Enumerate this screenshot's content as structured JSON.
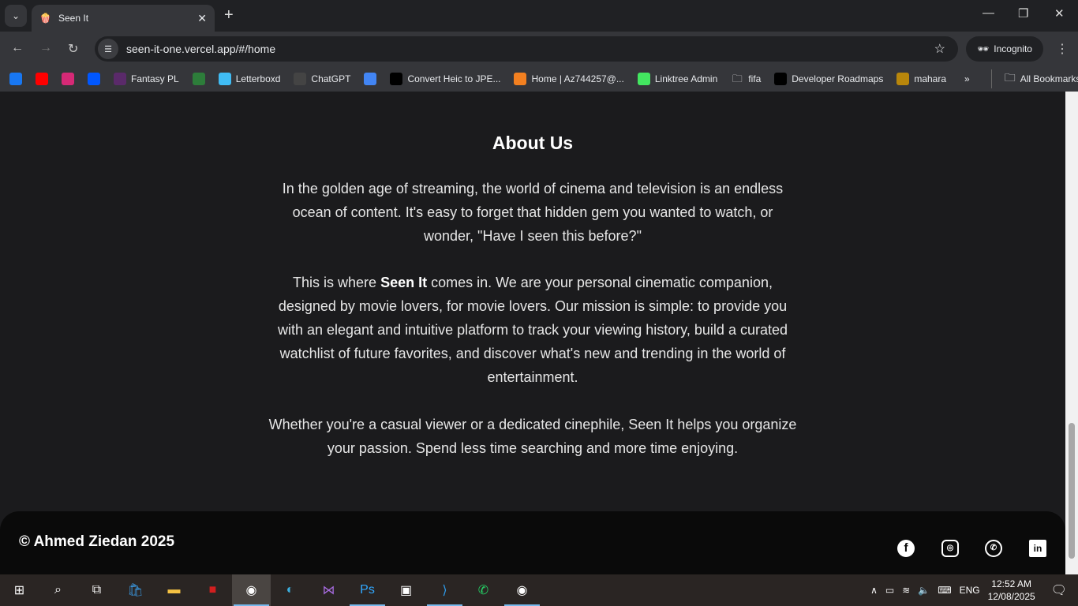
{
  "browser": {
    "tab_title": "Seen It",
    "url": "seen-it-one.vercel.app/#/home",
    "profile_label": "Incognito",
    "bookmarks": [
      {
        "label": "",
        "icon": "facebook-icon",
        "color": "#1877f2"
      },
      {
        "label": "",
        "icon": "youtube-icon",
        "color": "#ff0000"
      },
      {
        "label": "",
        "icon": "instagram-icon",
        "color": "#d62976"
      },
      {
        "label": "",
        "icon": "behance-icon",
        "color": "#0057ff"
      },
      {
        "label": "Fantasy PL",
        "icon": "premier-league-icon",
        "color": "#5a2a6a"
      },
      {
        "label": "",
        "icon": "live-icon",
        "color": "#2d7d3a"
      },
      {
        "label": "Letterboxd",
        "icon": "letterboxd-icon",
        "color": "#40bcf4"
      },
      {
        "label": "ChatGPT",
        "icon": "chatgpt-icon",
        "color": "#444444"
      },
      {
        "label": "",
        "icon": "google-translate-icon",
        "color": "#4285f4"
      },
      {
        "label": "Convert Heic to JPE...",
        "icon": "h-icon",
        "color": "#000000"
      },
      {
        "label": "Home | Az744257@...",
        "icon": "cloud-icon",
        "color": "#f38020"
      },
      {
        "label": "Linktree Admin",
        "icon": "linktree-icon",
        "color": "#43e660"
      },
      {
        "label": "fifa",
        "icon": "folder-icon",
        "color": "#35363a"
      },
      {
        "label": "Developer Roadmaps",
        "icon": "roadmap-icon",
        "color": "#000000"
      },
      {
        "label": "mahara",
        "icon": "mahara-icon",
        "color": "#b8860b"
      }
    ],
    "all_bookmarks_label": "All Bookmarks"
  },
  "main": {
    "heading": "About Us",
    "para1": "In the golden age of streaming, the world of cinema and television is an endless ocean of content. It's easy to forget that hidden gem you wanted to watch, or wonder, \"Have I seen this before?\"",
    "para2_prefix": "This is where ",
    "para2_bold": "Seen It",
    "para2_suffix": " comes in. We are your personal cinematic companion, designed by movie lovers, for movie lovers. Our mission is simple: to provide you with an elegant and intuitive platform to track your viewing history, build a curated watchlist of future favorites, and discover what's new and trending in the world of entertainment.",
    "para3": "Whether you're a casual viewer or a dedicated cinephile, Seen It helps you organize your passion. Spend less time searching and more time enjoying."
  },
  "footer": {
    "copyright": "© Ahmed Ziedan 2025",
    "social": [
      "facebook-icon",
      "instagram-icon",
      "whatsapp-icon",
      "linkedin-icon"
    ]
  },
  "taskbar": {
    "language": "ENG",
    "time": "12:52 AM",
    "date": "12/08/2025"
  }
}
